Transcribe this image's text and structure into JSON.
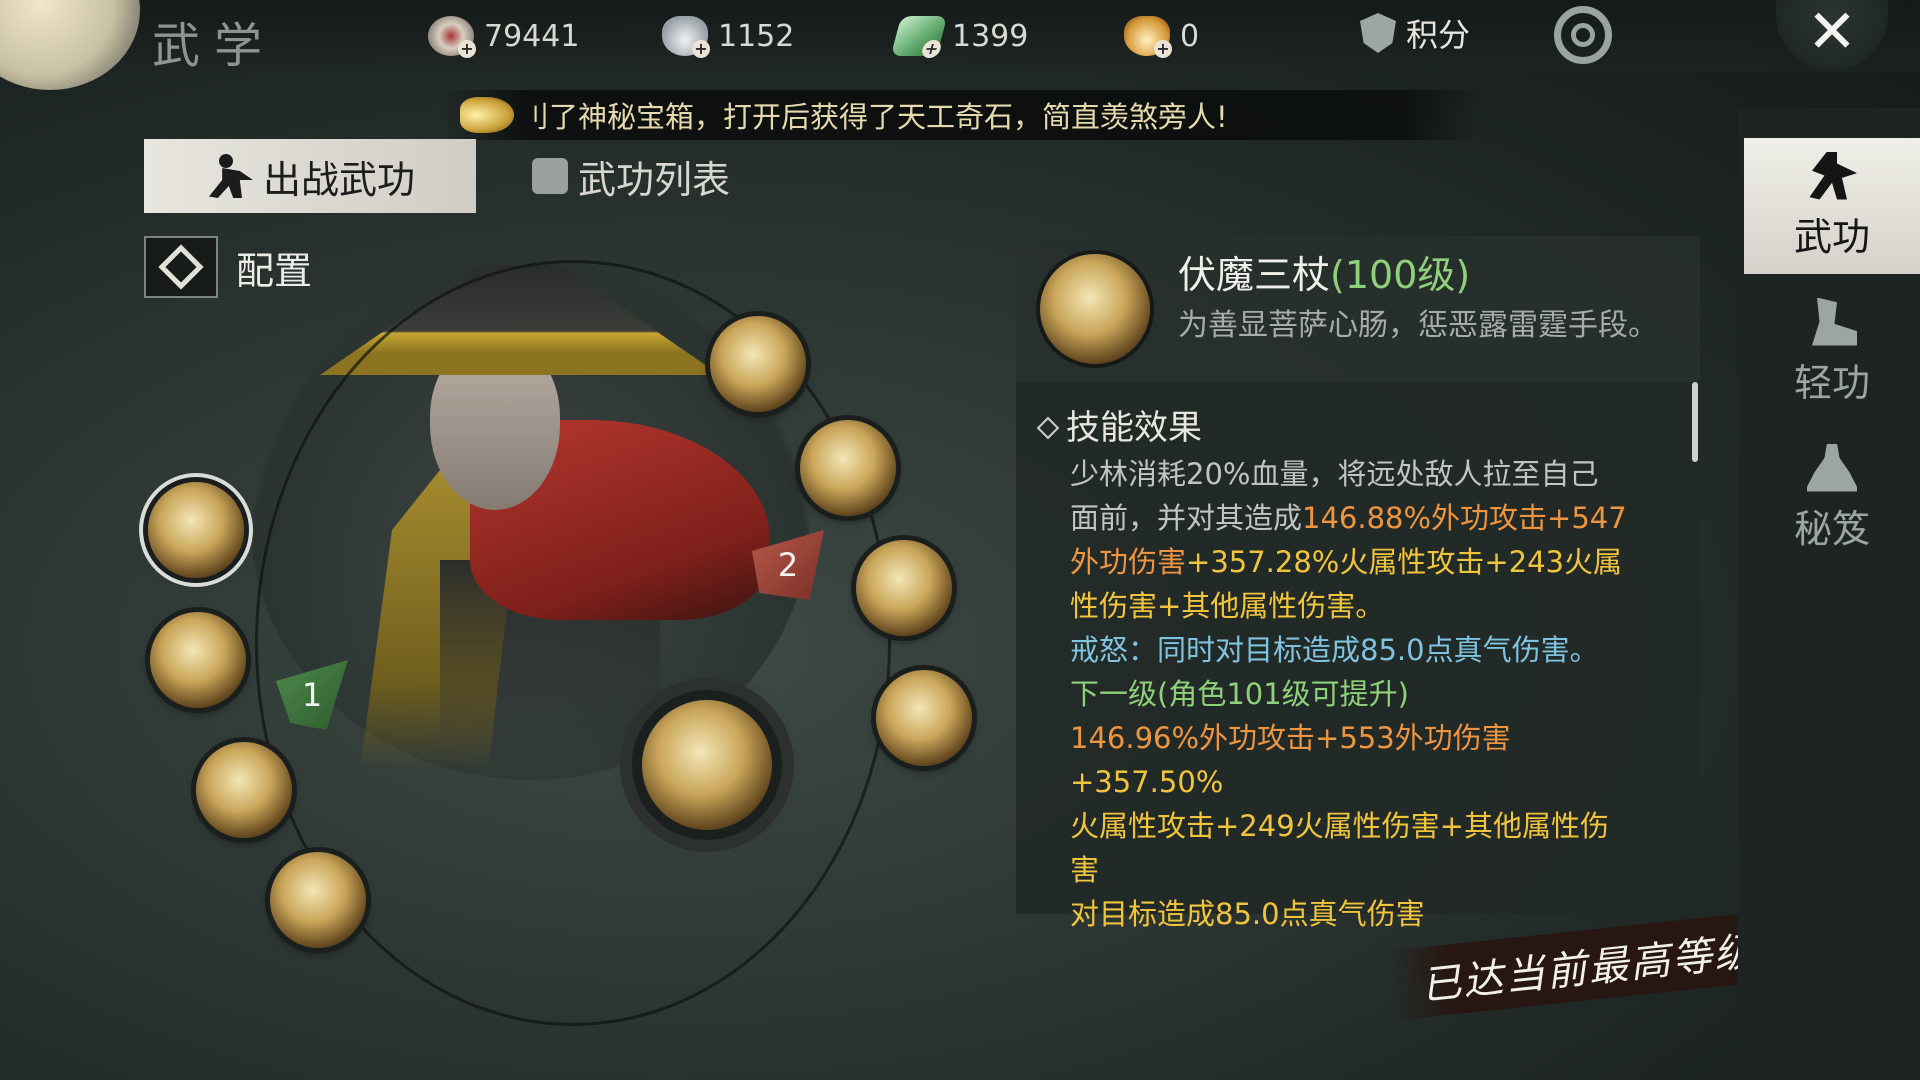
{
  "header": {
    "title": "武学",
    "currencies": [
      {
        "icon": "coin-icon",
        "value": "79441"
      },
      {
        "icon": "silver-ingot-icon",
        "value": "1152"
      },
      {
        "icon": "jade-icon",
        "value": "1399"
      },
      {
        "icon": "gold-ingot-icon",
        "value": "0"
      }
    ],
    "score_label": "积分",
    "close_label": "✕"
  },
  "announcement": "刂了神秘宝箱，打开后获得了天工奇石，简直羡煞旁人!",
  "tabs": [
    {
      "label": "出战武功",
      "active": true
    },
    {
      "label": "武功列表",
      "active": false
    }
  ],
  "config_label": "配置",
  "loadout": {
    "slot_1_label": "1",
    "slot_2_label": "2"
  },
  "skill": {
    "name": "伏魔三杖",
    "level": "(100级)",
    "motto": "为善显菩萨心肠，惩恶露雷霆手段。",
    "effects_heading": "技能效果",
    "lines": [
      {
        "text": "少林消耗20%血量，将远处敌人拉至自己",
        "color": "grey"
      },
      {
        "parts": [
          {
            "text": "面前，并对其造成",
            "color": "grey"
          },
          {
            "text": "146.88%外功攻击+547",
            "color": "orange"
          }
        ]
      },
      {
        "parts": [
          {
            "text": "外功伤害",
            "color": "orange"
          },
          {
            "text": "+357.28%火属性攻击+243火属",
            "color": "yellow"
          }
        ]
      },
      {
        "text": "性伤害+其他属性伤害。",
        "color": "yellow"
      },
      {
        "text": "戒怒：同时对目标造成85.0点真气伤害。",
        "color": "blue"
      },
      {
        "text": "下一级(角色101级可提升)",
        "color": "green"
      },
      {
        "parts": [
          {
            "text": "146.96%外功攻击+553外功伤害",
            "color": "orange"
          },
          {
            "text": "+357.50%",
            "color": "yellow"
          }
        ]
      },
      {
        "text": "火属性攻击+249火属性伤害+其他属性伤",
        "color": "yellow"
      },
      {
        "text": "害",
        "color": "yellow"
      },
      {
        "text": "对目标造成85.0点真气伤害",
        "color": "yellow"
      }
    ],
    "max_level_label": "已达当前最高等级"
  },
  "sidebar": {
    "items": [
      {
        "label": "武功",
        "active": true
      },
      {
        "label": "轻功",
        "active": false
      },
      {
        "label": "秘笈",
        "active": false
      }
    ]
  },
  "colors": {
    "orange": "#ee9540",
    "yellow": "#f1c43d",
    "blue": "#7fc3e0",
    "green": "#8fd07a"
  }
}
